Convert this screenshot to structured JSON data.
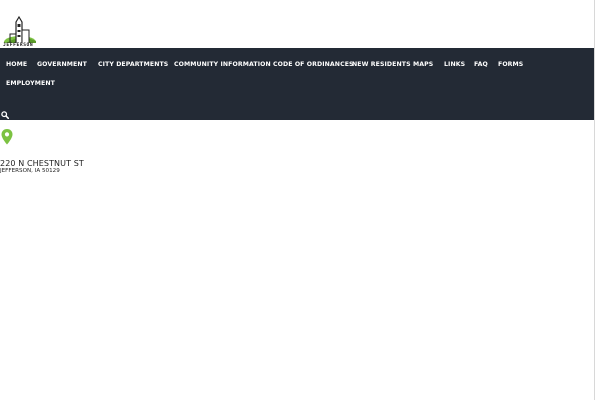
{
  "logo": {
    "text": "JEFFERSON",
    "icon": "city-hall-tower-logo",
    "accent_color": "#7cc242"
  },
  "nav": {
    "background_color": "#232a35",
    "items": [
      {
        "label": "HOME"
      },
      {
        "label": "GOVERNMENT"
      },
      {
        "label": "CITY DEPARTMENTS"
      },
      {
        "label": "COMMUNITY INFORMATION"
      },
      {
        "label": "CODE OF ORDINANCES"
      },
      {
        "label": "NEW RESIDENTS"
      },
      {
        "label": "MAPS"
      },
      {
        "label": "LINKS"
      },
      {
        "label": "FAQ"
      },
      {
        "label": "FORMS"
      },
      {
        "label": "EMPLOYMENT"
      }
    ],
    "search_icon": "search-icon"
  },
  "address": {
    "icon": "map-pin-icon",
    "icon_color": "#7cc242",
    "line1": "220 N CHESTNUT ST",
    "line2": "JEFFERSON, IA 50129"
  }
}
